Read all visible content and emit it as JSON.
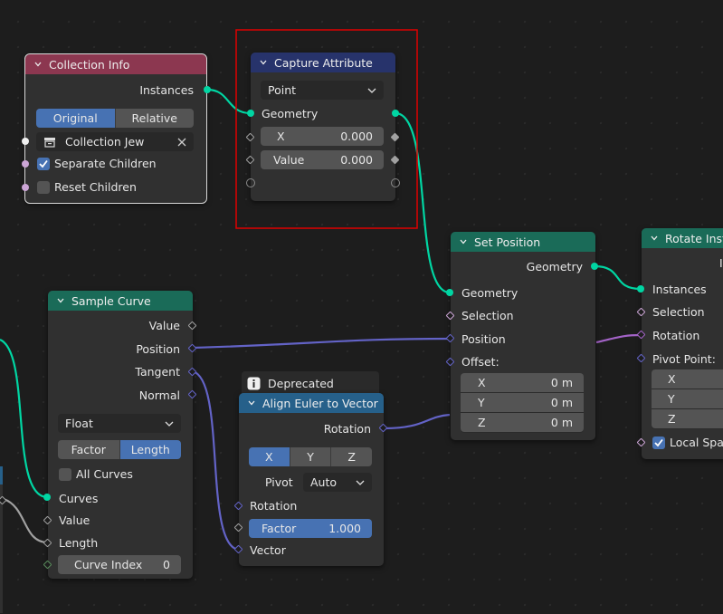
{
  "colors": {
    "geometry_socket": "#00d6a3",
    "vector_socket": "#6363c7",
    "rotation_socket": "#a363c7",
    "float_socket": "#a1a1a1",
    "int_socket": "#598c5c",
    "bool_socket": "#cca6d6",
    "collection_header": "#8c3750",
    "capture_header": "#27336b",
    "geo_header": "#1a6b58",
    "convert_header": "#26608a",
    "selection_box": "#e00000",
    "accent": "#4772b3"
  },
  "collection_info": {
    "title": "Collection Info",
    "output_instances": "Instances",
    "mode_original": "Original",
    "mode_relative": "Relative",
    "collection_value": "Collection Jew",
    "separate_children": "Separate Children",
    "reset_children": "Reset Children"
  },
  "capture_attribute": {
    "title": "Capture Attribute",
    "domain": "Point",
    "geometry": "Geometry",
    "x_label": "X",
    "x_value": "0.000",
    "value_label": "Value",
    "value_value": "0.000"
  },
  "set_position": {
    "title": "Set Position",
    "out_geometry": "Geometry",
    "in_geometry": "Geometry",
    "selection": "Selection",
    "position": "Position",
    "offset": "Offset:",
    "x_label": "X",
    "x_value": "0 m",
    "y_label": "Y",
    "y_value": "0 m",
    "z_label": "Z",
    "z_value": "0 m"
  },
  "rotate_instances": {
    "title": "Rotate Inst",
    "out_partial": "I",
    "instances": "Instances",
    "selection": "Selection",
    "rotation": "Rotation",
    "pivot_point": "Pivot Point:",
    "x_label": "X",
    "y_label": "Y",
    "z_label": "Z",
    "local_space": "Local Spac"
  },
  "sample_curve": {
    "title": "Sample Curve",
    "out_value": "Value",
    "out_position": "Position",
    "out_tangent": "Tangent",
    "out_normal": "Normal",
    "data_type": "Float",
    "mode_factor": "Factor",
    "mode_length": "Length",
    "all_curves": "All Curves",
    "in_curves": "Curves",
    "in_value": "Value",
    "in_length": "Length",
    "curve_index_label": "Curve Index",
    "curve_index_value": "0"
  },
  "align_euler": {
    "deprecated": "Deprecated",
    "title": "Align Euler to Vector",
    "out_rotation": "Rotation",
    "axis_x": "X",
    "axis_y": "Y",
    "axis_z": "Z",
    "pivot_label": "Pivot",
    "pivot_value": "Auto",
    "in_rotation": "Rotation",
    "factor_label": "Factor",
    "factor_value": "1.000",
    "in_vector": "Vector"
  }
}
